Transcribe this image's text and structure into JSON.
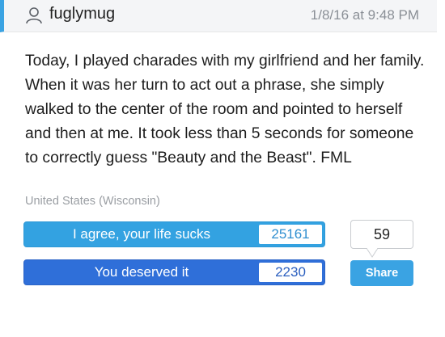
{
  "post": {
    "username": "fuglymug",
    "timestamp": "1/8/16 at 9:48 PM",
    "story": "Today, I played charades with my girlfriend and her family. When it was her turn to act out a phrase, she simply walked to the center of the room and pointed to herself and then at me. It took less than 5 seconds for someone to correctly guess \"Beauty and the Beast\". FML",
    "location": "United States (Wisconsin)"
  },
  "votes": {
    "agree_label": "I agree, your life sucks",
    "agree_count": "25161",
    "deserved_label": "You deserved it",
    "deserved_count": "2230"
  },
  "comments": {
    "count": "59"
  },
  "share": {
    "label": "Share"
  },
  "colors": {
    "accent": "#3aa3e3",
    "agree": "#33a2e1",
    "deserved": "#2f6fd9",
    "header_bg": "#f4f5f7"
  },
  "icons": {
    "user": "user-icon",
    "comment": "speech-bubble-icon"
  }
}
